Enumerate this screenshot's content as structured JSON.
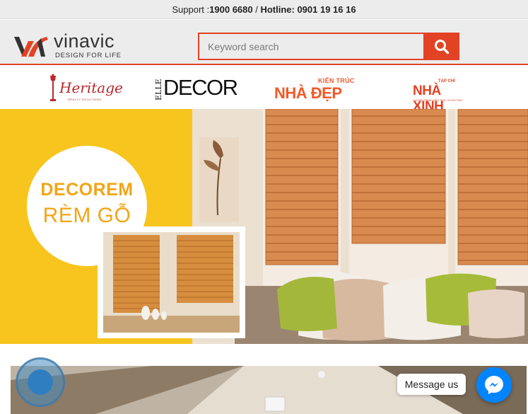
{
  "topbar": {
    "support_label": "Support : ",
    "support_number": "1900 6680",
    "separator": " / ",
    "hotline_label": "Hotline: ",
    "hotline_number": "0901 19 16 16"
  },
  "brand": {
    "name": "vinavic",
    "tagline": "DESIGN FOR LIFE",
    "accent_color": "#e24325"
  },
  "search": {
    "placeholder": "Keyword search",
    "icon": "search-icon"
  },
  "partners": [
    {
      "name": "Heritage",
      "sub": "REALTY SOLUTIONS"
    },
    {
      "name_a": "ELLE",
      "name_b": "DECOR"
    },
    {
      "top": "KIẾN TRÚC",
      "main": "NHÀ ĐẸP"
    },
    {
      "top": "TẠP CHÍ",
      "main": "NHÀ XINH",
      "sub": "CHUYÊN TRANG KIẾN TRÚC VÀ NỘI THẤT"
    }
  ],
  "hero": {
    "title_line1": "DECOREM",
    "title_line2": "RÈM GỖ"
  },
  "messenger": {
    "label": "Message us",
    "icon": "messenger-icon",
    "color": "#0084ff"
  }
}
